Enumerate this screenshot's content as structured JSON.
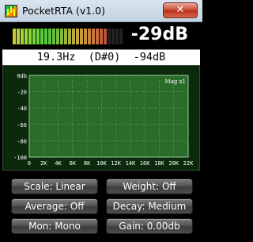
{
  "window": {
    "title": "PocketRTA (v1.0)",
    "close_label": "✕"
  },
  "meter": {
    "readout": "-29dB",
    "segment_colors": [
      "#c9c93a",
      "#b8d03a",
      "#a8d43a",
      "#98d83a",
      "#88d83a",
      "#78d63a",
      "#6ad23a",
      "#5ccf3a",
      "#56c93a",
      "#5ac43a",
      "#64c03a",
      "#74bc3a",
      "#86b83a",
      "#98b43a",
      "#a8b03a",
      "#b8ac3a",
      "#c5a53a",
      "#c99c3a",
      "#c98f3a",
      "#c9843a",
      "#c9783a",
      "#c76b3a",
      "#c45e3a",
      "#bf513a",
      "#222",
      "#222",
      "#222",
      "#222"
    ]
  },
  "info": {
    "frequency": "19.3Hz",
    "note": "(D#0)",
    "level": "-94dB"
  },
  "chart_data": {
    "type": "line",
    "title": "",
    "annotation": "Mag x1",
    "xlabel": "",
    "ylabel": "",
    "x_ticks": [
      "0",
      "2K",
      "4K",
      "6K",
      "8K",
      "10K",
      "12K",
      "14K",
      "16K",
      "18K",
      "20K",
      "22K"
    ],
    "y_ticks": [
      "0db",
      "-20",
      "-40",
      "-60",
      "-80",
      "-100"
    ],
    "xlim": [
      0,
      22000
    ],
    "ylim": [
      -100,
      0
    ],
    "grid": true,
    "background": "#2a6b2a",
    "grid_color": "#7fbf7f",
    "series": []
  },
  "controls": {
    "scale": "Scale: Linear",
    "weight": "Weight: Off",
    "average": "Average: Off",
    "decay": "Decay: Medium",
    "mon": "Mon: Mono",
    "gain": "Gain: 0.00db"
  }
}
